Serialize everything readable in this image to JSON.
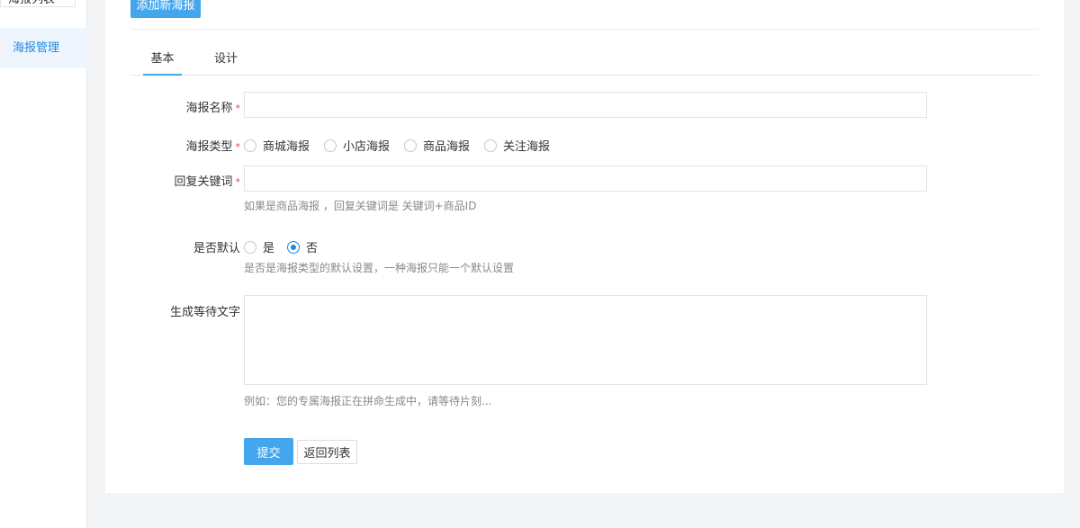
{
  "sidebar": {
    "top_tab_label": "海报列表",
    "items": [
      {
        "label": "海报管理"
      }
    ]
  },
  "toolbar": {
    "add_label": "添加新海报"
  },
  "tabs": [
    {
      "label": "基本",
      "active": true
    },
    {
      "label": "设计",
      "active": false
    }
  ],
  "form": {
    "name": {
      "label": "海报名称",
      "required_mark": "*",
      "value": "",
      "placeholder": ""
    },
    "type": {
      "label": "海报类型",
      "required_mark": "*",
      "options": [
        "商城海报",
        "小店海报",
        "商品海报",
        "关注海报"
      ],
      "selected": null
    },
    "keyword": {
      "label": "回复关键词",
      "required_mark": "*",
      "value": "",
      "placeholder": "",
      "hint": "如果是商品海报 ，回复关键词是 关键词+商品ID"
    },
    "is_default": {
      "label": "是否默认",
      "options": [
        "是",
        "否"
      ],
      "selected": "否",
      "hint": "是否是海报类型的默认设置，一种海报只能一个默认设置"
    },
    "wait_text": {
      "label": "生成等待文字",
      "value": "",
      "hint": "例如：您的专属海报正在拼命生成中，请等待片刻..."
    }
  },
  "actions": {
    "submit_label": "提交",
    "back_label": "返回列表"
  },
  "colors": {
    "accent": "#44a6ec",
    "radio_checked": "#1e88e5",
    "required": "#e04848"
  }
}
